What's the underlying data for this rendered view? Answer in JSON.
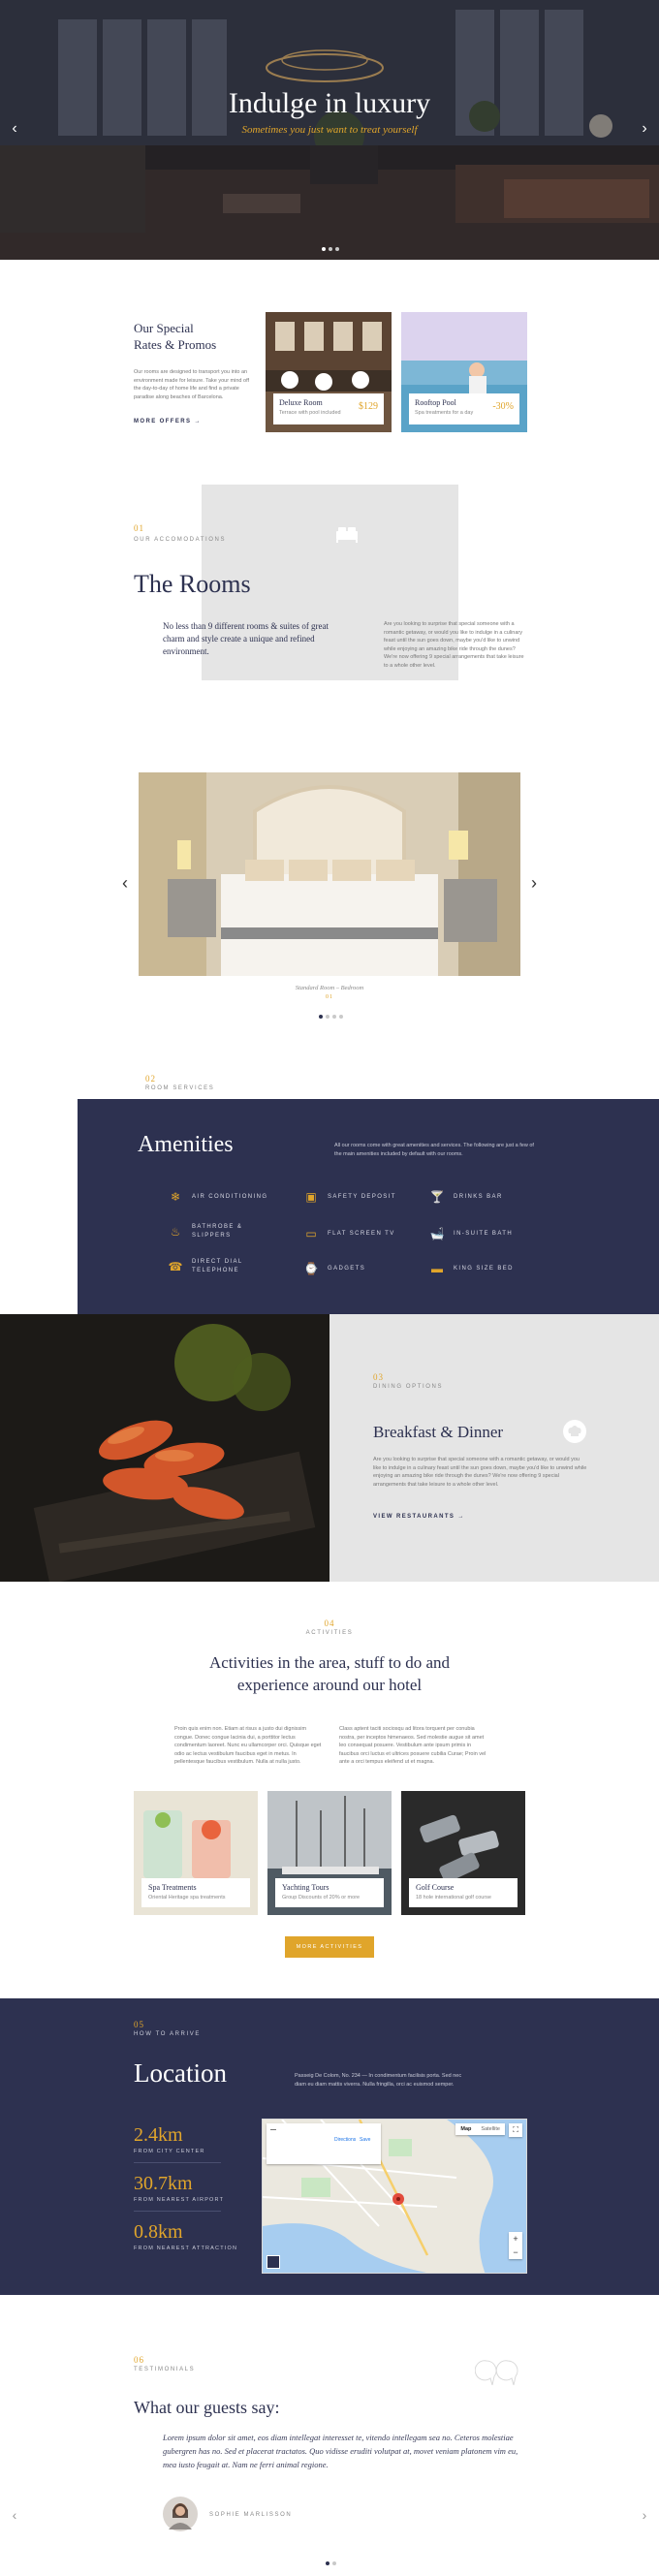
{
  "hero": {
    "title": "Indulge in luxury",
    "subtitle": "Sometimes you just want to treat yourself"
  },
  "rates": {
    "title_line1": "Our Special",
    "title_line2": "Rates & Promos",
    "description": "Our rooms are designed to transport you into an environment made for leisure. Take your mind off the day-to-day of home life and find a private paradise along beaches of Barcelona.",
    "more_offers": "MORE OFFERS",
    "cards": [
      {
        "title": "Deluxe Room",
        "desc": "Terrace with pool included",
        "price": "$129"
      },
      {
        "title": "Rooftop Pool",
        "desc": "Spa treatments for a day",
        "price": "-30%"
      }
    ]
  },
  "rooms": {
    "number": "01",
    "eyebrow": "OUR ACCOMODATIONS",
    "title": "The Rooms",
    "lead": "No less than 9 different rooms & suites of great charm and style create a unique and refined environment.",
    "body": "Are you looking to surprise that special someone with a romantic getaway, or would you like to indulge in a culinary feast until the sun goes down, maybe you'd like to unwind while enjoying an amazing bike ride through the dunes? We're now offering 9 special arrangements that take leisure to a whole other level.",
    "slide_caption": "Standard Room – Bedroom",
    "slide_number": "01"
  },
  "amenities": {
    "number": "02",
    "eyebrow": "ROOM SERVICES",
    "title": "Amenities",
    "intro": "All our rooms come with great amenities and services. The following are just a few of the main amenities included by default with our rooms.",
    "items": [
      {
        "icon": "air-conditioning-icon",
        "glyph": "❄",
        "label": "AIR CONDITIONING"
      },
      {
        "icon": "safety-deposit-icon",
        "glyph": "▣",
        "label": "SAFETY DEPOSIT"
      },
      {
        "icon": "drinks-bar-icon",
        "glyph": "🍸",
        "label": "DRINKS BAR"
      },
      {
        "icon": "bathrobe-icon",
        "glyph": "♨",
        "label_line1": "BATHROBE &",
        "label_line2": "SLIPPERS"
      },
      {
        "icon": "flat-screen-tv-icon",
        "glyph": "▭",
        "label": "FLAT SCREEN TV"
      },
      {
        "icon": "in-suite-bath-icon",
        "glyph": "🛁",
        "label": "IN-SUITE BATH"
      },
      {
        "icon": "telephone-icon",
        "glyph": "☎",
        "label_line1": "DIRECT DIAL",
        "label_line2": "TELEPHONE"
      },
      {
        "icon": "gadgets-icon",
        "glyph": "⌚",
        "label": "GADGETS"
      },
      {
        "icon": "king-size-bed-icon",
        "glyph": "▬",
        "label": "KING SIZE BED"
      }
    ]
  },
  "dining": {
    "number": "03",
    "eyebrow": "DINING OPTIONS",
    "title": "Breakfast & Dinner",
    "body": "Are you looking to surprise that special someone with a romantic getaway, or would you like to indulge in a culinary feast until the sun goes down, maybe you'd like to unwind while enjoying an amazing bike ride through the dunes? We're now offering 9 special arrangements that take leisure to a whole other level.",
    "link": "VIEW RESTAURANTS"
  },
  "activities": {
    "number": "04",
    "eyebrow": "ACTIVITIES",
    "title_line1": "Activities in the area, stuff to do and",
    "title_line2": "experience around our hotel",
    "col1": "Proin quis enim non. Etiam at risus a justo dui dignissim congue. Donec congue lacinia dui, a porttitor lectus condimentum laoreet. Nunc eu ullamcorper orci. Quisque eget odio ac lectus vestibulum faucibus eget in metus. In pellentesque faucibus vestibulum. Nulla at nulla justo.",
    "col2": "Class aptent taciti sociosqu ad litora torquent per conubia nostra, per inceptos himenaeos. Sed molestie augue sit amet leo consequat posuere. Vestibulum ante ipsum primis in faucibus orci luctus et ultrices posuere cubilia Curae; Proin vel ante a orci tempus eleifend ut et magna.",
    "cards": [
      {
        "title": "Spa Treatments",
        "desc": "Oriental Heritage spa treatments"
      },
      {
        "title": "Yachting Tours",
        "desc": "Group Discounts of 20% or more"
      },
      {
        "title": "Golf Course",
        "desc": "18 hole international golf course"
      }
    ],
    "button": "MORE ACTIVITIES"
  },
  "location": {
    "number": "05",
    "eyebrow": "HOW TO ARRIVE",
    "title": "Location",
    "address": "Passeig De Colom, No. 234 — In condimentum facilisis porta. Sed nec diam eu diam mattis viverra. Nulla fringilla, orci ac euismod semper.",
    "stats": [
      {
        "value": "2.4km",
        "label": "FROM CITY CENTER"
      },
      {
        "value": "30.7km",
        "label": "FROM NEAREST AIRPORT"
      },
      {
        "value": "0.8km",
        "label": "FROM NEAREST ATTRACTION"
      }
    ],
    "map": {
      "tab_map": "Map",
      "tab_satellite": "Satellite",
      "directions": "Directions",
      "save": "Save"
    }
  },
  "testimonials": {
    "number": "06",
    "eyebrow": "TESTIMONIALS",
    "title": "What our guests say:",
    "quote": "Lorem ipsum dolor sit amet, eos diam intellegat interesset te, vitendo intellegam sea no. Ceteros molestiae gubergren has no. Sed et placerat tractatos. Quo vidisse eruditi volutpat at, movet veniam platonem vim eu, mea iusto feugait at. Nam ne ferri animal regione.",
    "author": "SOPHIE MARLISSON"
  },
  "colors": {
    "navy": "#2d3150",
    "gold": "#e0a52b",
    "grey_panel": "#e5e5e5"
  }
}
